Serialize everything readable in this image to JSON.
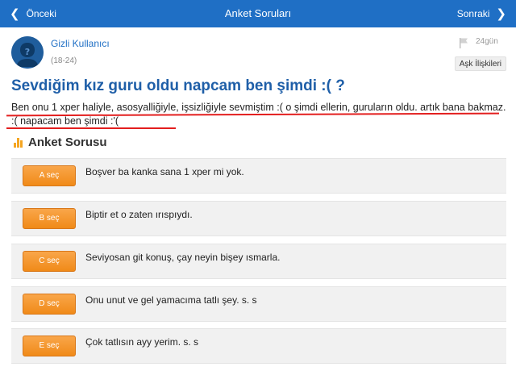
{
  "nav": {
    "back_label": "Önceki",
    "title": "Anket Soruları",
    "next_label": "Sonraki"
  },
  "author": {
    "name": "Gizli Kullanıcı",
    "age_range": "(18-24)"
  },
  "meta": {
    "time_ago": "24gün",
    "category": "Aşk İlişkileri"
  },
  "question": {
    "title": "Sevdiğim kız guru oldu napcam ben şimdi :( ?",
    "body": "Ben onu 1 xper haliyle, asosyalliğiyle, işsizliğiyle sevmiştim :( o şimdi ellerin, guruların oldu. artık bana bakmaz. :( napacam ben şimdi :'("
  },
  "poll": {
    "heading": "Anket Sorusu",
    "options": [
      {
        "button": "A seç",
        "text": "Boşver ba kanka sana 1 xper mi yok."
      },
      {
        "button": "B seç",
        "text": "Biptir et o zaten ırıspıydı."
      },
      {
        "button": "C seç",
        "text": "Seviyosan git konuş, çay neyin bişey ısmarla."
      },
      {
        "button": "D seç",
        "text": "Onu unut ve gel yamacıma tatlı şey. s. s"
      },
      {
        "button": "E seç",
        "text": "Çok tatlısın ayy yerim. s. s"
      }
    ]
  },
  "colors": {
    "topbar": "#1f6fc5",
    "title": "#1f5fa8",
    "accent_button": "#f08a18",
    "annotation": "#e31e1e"
  }
}
